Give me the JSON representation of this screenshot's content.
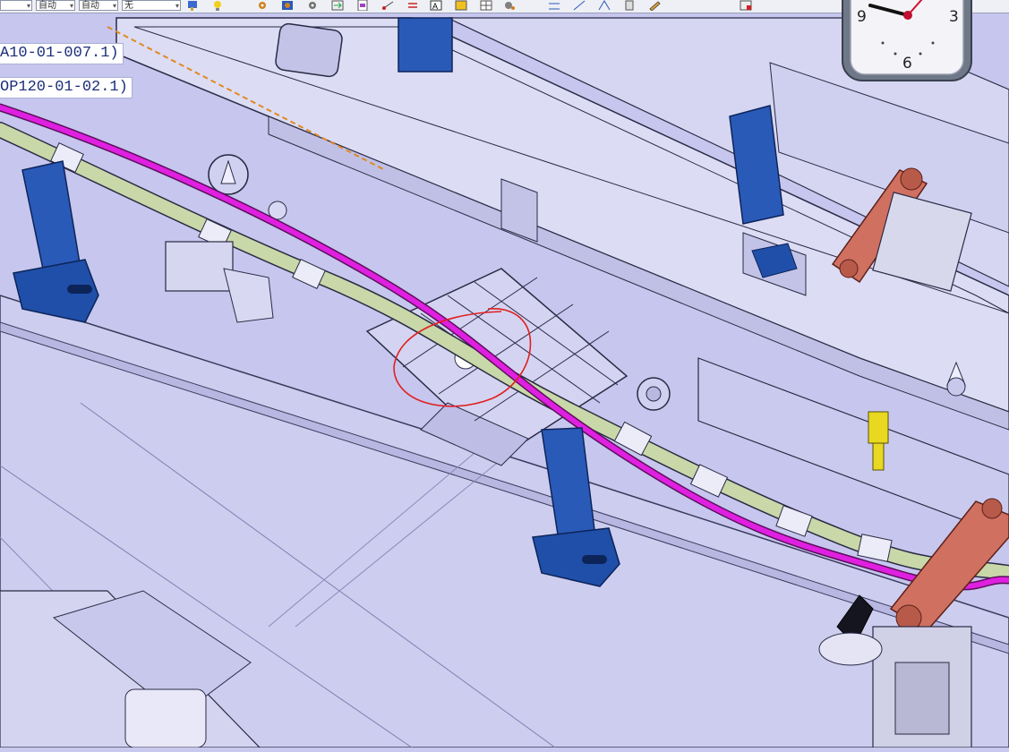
{
  "toolbar": {
    "combo_1": "",
    "combo_2": "自动",
    "combo_3": "自动",
    "combo_4": "无"
  },
  "labels": {
    "part_1": "A10-01-007.1)",
    "part_2": "OP120-01-02.1)"
  },
  "clock": {
    "numbers": [
      "9",
      "3",
      "6"
    ]
  },
  "colors": {
    "background": "#c9c9ef",
    "structure": "#dcdcf4",
    "edges": "#2a2a44",
    "cable_magenta": "#e020e0",
    "cable_green": "#c8d8a8",
    "support_blue": "#1f4fa8",
    "clamp_red": "#d07060",
    "annotation_red": "#e02020"
  }
}
